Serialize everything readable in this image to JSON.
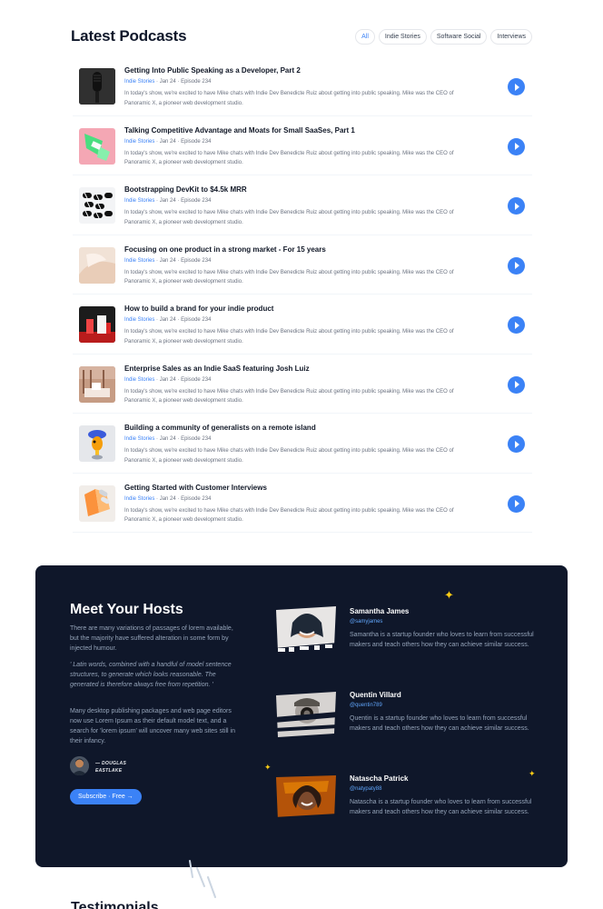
{
  "podcasts": {
    "title": "Latest Podcasts",
    "filters": [
      "All",
      "Indie Stories",
      "Software Social",
      "Interviews"
    ],
    "episodes": [
      {
        "title": "Getting Into Public Speaking as a Developer, Part 2",
        "category": "Indie Stories",
        "date": "Jan 24",
        "episode": "Episode 234",
        "description": "In today's show, we're excited to have Mike chats with Indie Dev Benedicte Ruiz about getting into public speaking. Mike was the CEO of Panoramic X, a pioneer web development studio."
      },
      {
        "title": "Talking Competitive Advantage and Moats for Small SaaSes, Part 1",
        "category": "Indie Stories",
        "date": "Jan 24",
        "episode": "Episode 234",
        "description": "In today's show, we're excited to have Mike chats with Indie Dev Benedicte Ruiz about getting into public speaking. Mike was the CEO of Panoramic X, a pioneer web development studio."
      },
      {
        "title": "Bootstrapping DevKit to $4.5k MRR",
        "category": "Indie Stories",
        "date": "Jan 24",
        "episode": "Episode 234",
        "description": "In today's show, we're excited to have Mike chats with Indie Dev Benedicte Ruiz about getting into public speaking. Mike was the CEO of Panoramic X, a pioneer web development studio."
      },
      {
        "title": "Focusing on one product in a strong market - For 15 years",
        "category": "Indie Stories",
        "date": "Jan 24",
        "episode": "Episode 234",
        "description": "In today's show, we're excited to have Mike chats with Indie Dev Benedicte Ruiz about getting into public speaking. Mike was the CEO of Panoramic X, a pioneer web development studio."
      },
      {
        "title": "How to build a brand for your indie product",
        "category": "Indie Stories",
        "date": "Jan 24",
        "episode": "Episode 234",
        "description": "In today's show, we're excited to have Mike chats with Indie Dev Benedicte Ruiz about getting into public speaking. Mike was the CEO of Panoramic X, a pioneer web development studio."
      },
      {
        "title": "Enterprise Sales as an Indie SaaS featuring Josh Luiz",
        "category": "Indie Stories",
        "date": "Jan 24",
        "episode": "Episode 234",
        "description": "In today's show, we're excited to have Mike chats with Indie Dev Benedicte Ruiz about getting into public speaking. Mike was the CEO of Panoramic X, a pioneer web development studio."
      },
      {
        "title": "Building a community of generalists on a remote island",
        "category": "Indie Stories",
        "date": "Jan 24",
        "episode": "Episode 234",
        "description": "In today's show, we're excited to have Mike chats with Indie Dev Benedicte Ruiz about getting into public speaking. Mike was the CEO of Panoramic X, a pioneer web development studio."
      },
      {
        "title": "Getting Started with Customer Interviews",
        "category": "Indie Stories",
        "date": "Jan 24",
        "episode": "Episode 234",
        "description": "In today's show, we're excited to have Mike chats with Indie Dev Benedicte Ruiz about getting into public speaking. Mike was the CEO of Panoramic X, a pioneer web development studio."
      }
    ]
  },
  "hosts": {
    "title": "Meet Your Hosts",
    "intro": "There are many variations of passages of lorem available, but the majority have suffered alteration in some form by injected humour.",
    "quote": "' Latin words, combined with a handful of model sentence structures, to generate which looks reasonable. The generated is therefore always free from repetition. '",
    "more": "Many desktop publishing packages and web page editors now use Lorem Ipsum as their default model text, and a search for 'lorem ipsum' will uncover many web sites still in their infancy.",
    "author": "— Douglas Eastlake",
    "subscribe_label": "Subscribe · Free →",
    "people": [
      {
        "name": "Samantha James",
        "handle": "@samyjames",
        "bio": "Samantha is a startup founder who loves to learn from successful makers and teach others how they can achieve similar success."
      },
      {
        "name": "Quentin Villard",
        "handle": "@quentin789",
        "bio": "Quentin is a startup founder who loves to learn from successful makers and teach others how they can achieve similar success."
      },
      {
        "name": "Natascha Patrick",
        "handle": "@natypaty88",
        "bio": "Natascha is a startup founder who loves to learn from successful makers and teach others how they can achieve similar success."
      }
    ]
  },
  "testimonials": {
    "title": "Testimonials"
  },
  "colors": {
    "accent": "#3b82f6",
    "dark_panel": "#0f172a",
    "sparkle": "#facc15"
  }
}
